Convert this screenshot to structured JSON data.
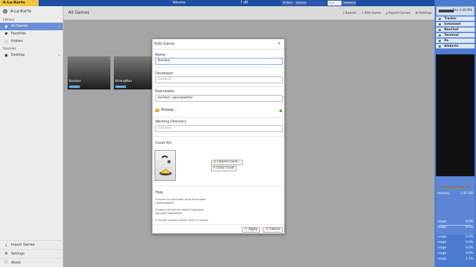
{
  "taskbar": {
    "app_label": "A-La-Karte",
    "volume_label": "Volume",
    "volume_value": "7 dB",
    "windows": [
      "OS Barn",
      "Terminal q",
      "",
      "A-La...",
      "Desktop ju"
    ]
  },
  "sidebar": {
    "app_title": "A-La-Karte",
    "section_library": "Library",
    "items": [
      {
        "label": "All Games",
        "icon": "gamepad-icon"
      },
      {
        "label": "Favorites",
        "icon": "heart-icon"
      },
      {
        "label": "Hidden",
        "icon": "eye-off-icon"
      }
    ],
    "section_sources": "Sources",
    "sources": [
      {
        "label": "Desktop",
        "icon": "desktop-icon"
      }
    ],
    "bottom": [
      {
        "label": "Import Games",
        "icon": "import-icon"
      },
      {
        "label": "Settings",
        "icon": "gear-icon"
      },
      {
        "label": "About",
        "icon": "info-icon"
      }
    ]
  },
  "main": {
    "title": "All Games",
    "actions": {
      "search": "Search",
      "add": "Add Game",
      "import": "Import Games",
      "settings": "Settings"
    },
    "games": [
      {
        "name": "Bomber",
        "badge": "Desktop"
      },
      {
        "name": "KHangMan",
        "badge": "Desktop"
      }
    ]
  },
  "dialog": {
    "title": "Edit Game",
    "close": "✕",
    "name_label": "Name",
    "name_value": "Bomber",
    "developer_label": "Developer",
    "developer_placeholder": "Optional",
    "executable_label": "Executable",
    "executable_value": "bomber -qwindowtitle",
    "browse": "Browse...",
    "workdir_label": "Working Directory",
    "workdir_placeholder": "Optional",
    "cover_label": "Cover Art",
    "choose_cover": "Choose Cover...",
    "clear_cover": "Clear Cover",
    "help_label": "Help",
    "help_lines": [
      "To launch an executable, enter its full path:",
      "\"/path/to/game\"",
      "To open a file with the default application:",
      "xdg-open \"/path/to/file\"",
      "If the path contains spaces, wrap it in quotes."
    ],
    "apply": "Apply",
    "cancel": "Cancel"
  },
  "right_panel": {
    "clock": "Thu 4:00 PM",
    "tabs": [
      "Tracker",
      "Iceweasel",
      "NeoChat",
      "Terminal",
      "Pe",
      "Alakarte"
    ],
    "memory_label": "memory",
    "memory_value": "1.67 GiB",
    "usage": [
      {
        "label": "usage",
        "value": "0.2%"
      },
      {
        "label": "usage",
        "value": "0.0%"
      },
      {
        "label": "usage",
        "value": "0.2%"
      },
      {
        "label": "usage",
        "value": "0.0%"
      },
      {
        "label": "usage",
        "value": "0.0%"
      },
      {
        "label": "usage",
        "value": "0.0%"
      },
      {
        "label": "usage",
        "value": "1.5%"
      }
    ]
  }
}
